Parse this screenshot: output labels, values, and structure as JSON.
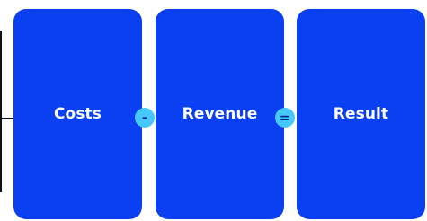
{
  "colors": {
    "card": "#0b3ff2",
    "operator_bg": "#46c8ff",
    "operator_text": "#0b2a8a",
    "bracket": "#111111"
  },
  "diagram": {
    "cards": [
      {
        "label": "Costs"
      },
      {
        "label": "Revenue"
      },
      {
        "label": "Result"
      }
    ],
    "operators": [
      {
        "symbol": "-"
      },
      {
        "symbol": "="
      }
    ]
  }
}
